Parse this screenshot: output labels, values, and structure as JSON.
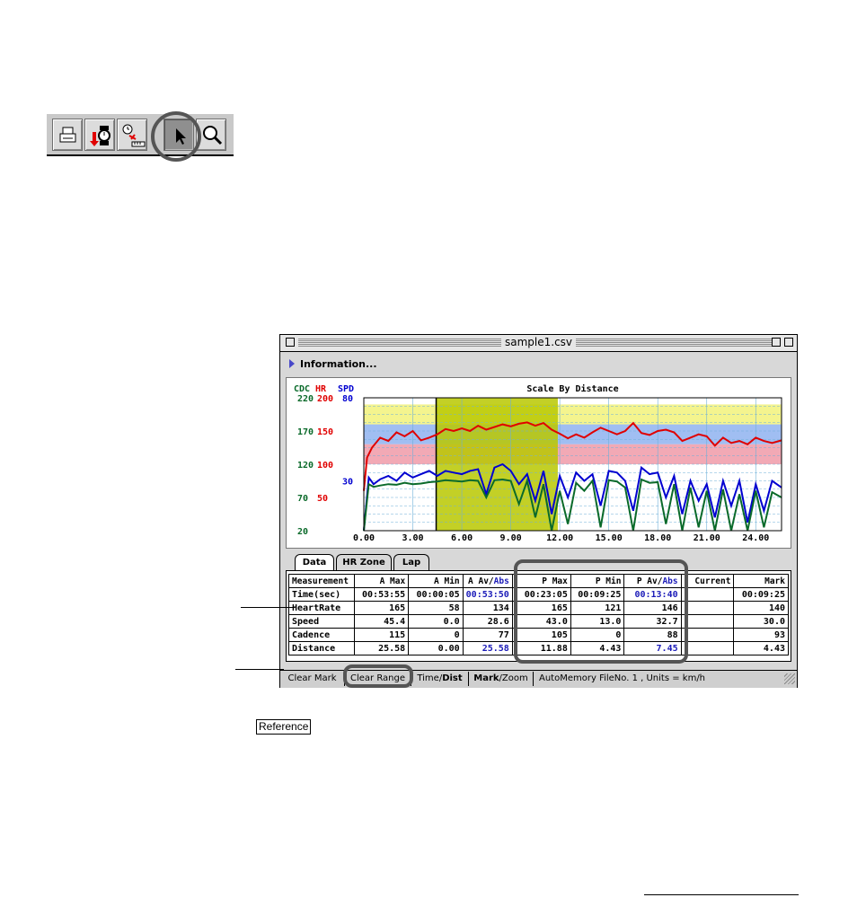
{
  "toolbar": {
    "buttons": [
      {
        "name": "print-button",
        "icon": "printer-icon"
      },
      {
        "name": "download-button",
        "icon": "watch-download-icon"
      },
      {
        "name": "time-distance-button",
        "icon": "clock-ruler-icon"
      },
      {
        "name": "pointer-button",
        "icon": "arrow-pointer-icon",
        "active": true
      },
      {
        "name": "zoom-button",
        "icon": "magnifier-icon"
      }
    ]
  },
  "window": {
    "title": "sample1.csv",
    "info_label": "Information..."
  },
  "chart_data": {
    "type": "line",
    "title": "Scale By Distance",
    "axis_headers": {
      "cdc": "CDC",
      "hr": "HR",
      "spd": "SPD"
    },
    "cdc_ticks": [
      "220",
      "170",
      "120",
      "70",
      "20"
    ],
    "hr_ticks": [
      "200",
      "150",
      "100",
      "50"
    ],
    "spd_ticks": [
      "80",
      "30"
    ],
    "x_ticks": [
      "0.00",
      "3.00",
      "6.00",
      "9.00",
      "12.00",
      "15.00",
      "18.00",
      "21.00",
      "24.00"
    ],
    "xlim": [
      0,
      25.58
    ],
    "hr_ylim": [
      0,
      200
    ],
    "spd_ylim": [
      0,
      80
    ],
    "cdc_ylim": [
      20,
      220
    ],
    "selected_range": [
      4.43,
      11.88
    ],
    "hr_zones": [
      {
        "from": 160,
        "to": 190,
        "color": "#f2f27a"
      },
      {
        "from": 130,
        "to": 160,
        "color": "#8fb3f0"
      },
      {
        "from": 100,
        "to": 130,
        "color": "#f09aa8"
      }
    ],
    "series": [
      {
        "name": "HR",
        "color": "#e00000",
        "x": [
          0,
          0.2,
          0.5,
          1,
          1.5,
          2,
          2.5,
          3,
          3.5,
          4,
          4.5,
          5,
          5.5,
          6,
          6.5,
          7,
          7.5,
          8,
          8.5,
          9,
          9.5,
          10,
          10.5,
          11,
          11.5,
          12,
          12.5,
          13,
          13.5,
          14,
          14.5,
          15,
          15.5,
          16,
          16.5,
          17,
          17.5,
          18,
          18.5,
          19,
          19.5,
          20,
          20.5,
          21,
          21.5,
          22,
          22.5,
          23,
          23.5,
          24,
          24.5,
          25,
          25.58
        ],
        "y": [
          60,
          110,
          125,
          140,
          135,
          148,
          142,
          150,
          136,
          140,
          145,
          153,
          150,
          154,
          150,
          158,
          152,
          156,
          160,
          157,
          161,
          163,
          158,
          162,
          152,
          146,
          139,
          145,
          140,
          148,
          155,
          150,
          145,
          150,
          162,
          147,
          144,
          150,
          152,
          148,
          135,
          140,
          145,
          142,
          128,
          140,
          132,
          135,
          130,
          140,
          135,
          132,
          136
        ]
      },
      {
        "name": "SPD",
        "color": "#0000d0",
        "x": [
          0,
          0.3,
          0.6,
          1,
          1.5,
          2,
          2.5,
          3,
          3.5,
          4,
          4.5,
          5,
          5.5,
          6,
          6.5,
          7,
          7.5,
          8,
          8.5,
          9,
          9.5,
          10,
          10.5,
          11,
          11.5,
          12,
          12.5,
          13,
          13.5,
          14,
          14.5,
          15,
          15.5,
          16,
          16.5,
          17,
          17.5,
          18,
          18.5,
          19,
          19.5,
          20,
          20.5,
          21,
          21.5,
          22,
          22.5,
          23,
          23.5,
          24,
          24.5,
          25,
          25.58
        ],
        "y": [
          0,
          32,
          28,
          31,
          33,
          30,
          35,
          32,
          34,
          36,
          33,
          36,
          35,
          34,
          36,
          37,
          22,
          38,
          40,
          36,
          28,
          34,
          18,
          36,
          10,
          33,
          20,
          35,
          30,
          34,
          15,
          36,
          35,
          30,
          12,
          38,
          34,
          35,
          20,
          33,
          10,
          30,
          18,
          28,
          8,
          30,
          15,
          30,
          5,
          28,
          12,
          30,
          26
        ]
      },
      {
        "name": "CDC",
        "color": "#0a6a2a",
        "x": [
          0,
          0.3,
          0.6,
          1,
          1.5,
          2,
          2.5,
          3,
          3.5,
          4,
          4.5,
          5,
          5.5,
          6,
          6.5,
          7,
          7.5,
          8,
          8.5,
          9,
          9.5,
          10,
          10.5,
          11,
          11.5,
          12,
          12.5,
          13,
          13.5,
          14,
          14.5,
          15,
          15.5,
          16,
          16.5,
          17,
          17.5,
          18,
          18.5,
          19,
          19.5,
          20,
          20.5,
          21,
          21.5,
          22,
          22.5,
          23,
          23.5,
          24,
          24.5,
          25,
          25.58
        ],
        "y": [
          20,
          90,
          86,
          88,
          90,
          89,
          92,
          90,
          91,
          93,
          94,
          96,
          95,
          94,
          96,
          95,
          70,
          96,
          97,
          95,
          60,
          95,
          40,
          90,
          20,
          80,
          30,
          92,
          80,
          95,
          25,
          96,
          94,
          85,
          20,
          97,
          92,
          93,
          30,
          90,
          20,
          85,
          25,
          80,
          20,
          82,
          20,
          75,
          20,
          80,
          25,
          78,
          70
        ]
      }
    ]
  },
  "tabs": [
    "Data",
    "HR Zone",
    "Lap"
  ],
  "table": {
    "headers": [
      "Measurement",
      "A Max",
      "A Min",
      "A Av/Abs",
      "P Max",
      "P Min",
      "P Av/Abs",
      "Current",
      "Mark"
    ],
    "rows": [
      [
        "Time(sec)",
        "00:53:55",
        "00:00:05",
        "00:53:50",
        "00:23:05",
        "00:09:25",
        "00:13:40",
        "",
        "00:09:25"
      ],
      [
        "HeartRate",
        "165",
        "58",
        "134",
        "165",
        "121",
        "146",
        "",
        "140"
      ],
      [
        "Speed",
        "45.4",
        "0.0",
        "28.6",
        "43.0",
        "13.0",
        "32.7",
        "",
        "30.0"
      ],
      [
        "Cadence",
        "115",
        "0",
        "77",
        "105",
        "0",
        "88",
        "",
        "93"
      ],
      [
        "Distance",
        "25.58",
        "0.00",
        "25.58",
        "11.88",
        "4.43",
        "7.45",
        "",
        "4.43"
      ]
    ]
  },
  "statusbar": {
    "clear_mark": "Clear Mark",
    "clear_range": "Clear Range",
    "time_prefix": "Time/",
    "time_bold": "Dist",
    "mark_bold": "Mark",
    "mark_suffix": "/Zoom",
    "info": "AutoMemory FileNo. 1 , Units = km/h"
  },
  "reference_label": "Reference",
  "colors": {
    "hr": "#e00000",
    "spd": "#0000d0",
    "cdc": "#0a6a2a",
    "highlight": "#b8c800"
  }
}
